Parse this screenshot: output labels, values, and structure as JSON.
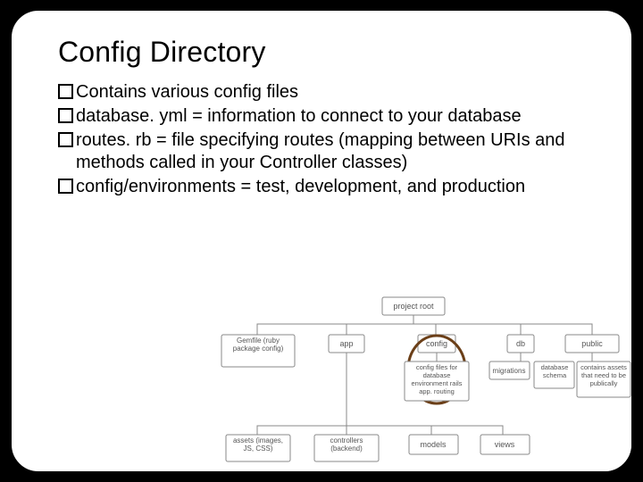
{
  "title": "Config Directory",
  "bullets": [
    {
      "text": "Contains various config files"
    },
    {
      "text": "database. yml = information to connect to your database"
    },
    {
      "text": "routes. rb = file specifying routes (mapping between URIs and methods called in your Controller classes)"
    },
    {
      "text": "config/environments = test, development, and production"
    }
  ],
  "diagram": {
    "root": "project root",
    "level1": [
      "Gemfile (ruby package config)",
      "app",
      "config",
      "db",
      "public"
    ],
    "config_note": "config files for database environment rails app. routing",
    "db_note": "migrations",
    "db_note2": "database schema",
    "public_note": "contains assets that need to be publically",
    "app_children": [
      "assets (images, JS, CSS)",
      "controllers (backend)",
      "models",
      "views"
    ],
    "highlight": "config"
  }
}
